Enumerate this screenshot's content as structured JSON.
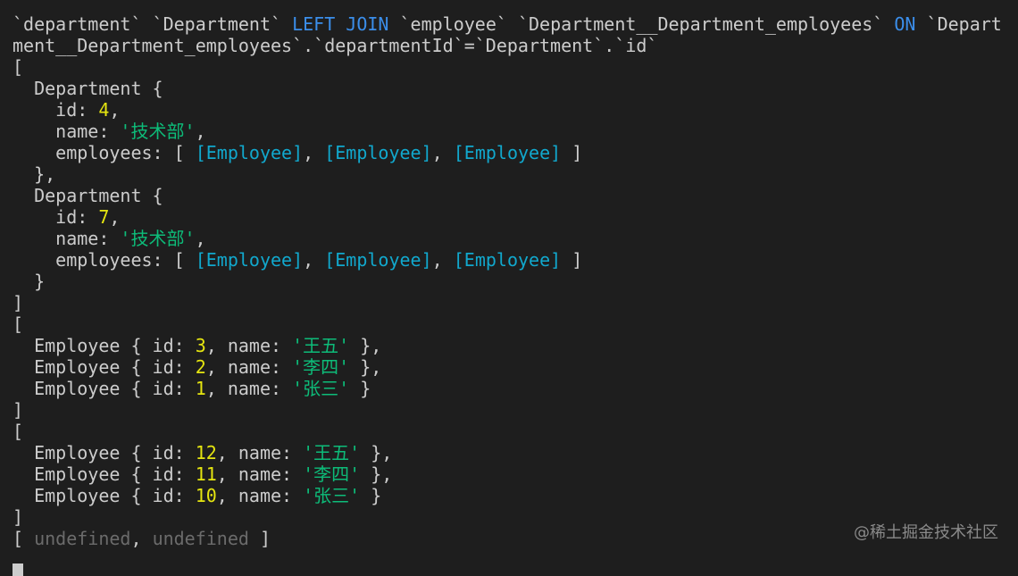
{
  "lines": [
    [
      {
        "t": "`department` `Department` ",
        "c": "def"
      },
      {
        "t": "LEFT JOIN",
        "c": "kw"
      },
      {
        "t": " `employee` `Department__Department_employees` ",
        "c": "def"
      },
      {
        "t": "ON",
        "c": "kw"
      },
      {
        "t": " `Depart",
        "c": "def"
      }
    ],
    [
      {
        "t": "ment__Department_employees`.`departmentId`=`Department`.`id`",
        "c": "def"
      }
    ],
    [
      {
        "t": "[",
        "c": "def"
      }
    ],
    [
      {
        "t": "  Department {",
        "c": "def"
      }
    ],
    [
      {
        "t": "    id: ",
        "c": "def"
      },
      {
        "t": "4",
        "c": "num"
      },
      {
        "t": ",",
        "c": "def"
      }
    ],
    [
      {
        "t": "    name: ",
        "c": "def"
      },
      {
        "t": "'技术部'",
        "c": "str"
      },
      {
        "t": ",",
        "c": "def"
      }
    ],
    [
      {
        "t": "    employees: [ ",
        "c": "def"
      },
      {
        "t": "[Employee]",
        "c": "cls"
      },
      {
        "t": ", ",
        "c": "def"
      },
      {
        "t": "[Employee]",
        "c": "cls"
      },
      {
        "t": ", ",
        "c": "def"
      },
      {
        "t": "[Employee]",
        "c": "cls"
      },
      {
        "t": " ]",
        "c": "def"
      }
    ],
    [
      {
        "t": "  },",
        "c": "def"
      }
    ],
    [
      {
        "t": "  Department {",
        "c": "def"
      }
    ],
    [
      {
        "t": "    id: ",
        "c": "def"
      },
      {
        "t": "7",
        "c": "num"
      },
      {
        "t": ",",
        "c": "def"
      }
    ],
    [
      {
        "t": "    name: ",
        "c": "def"
      },
      {
        "t": "'技术部'",
        "c": "str"
      },
      {
        "t": ",",
        "c": "def"
      }
    ],
    [
      {
        "t": "    employees: [ ",
        "c": "def"
      },
      {
        "t": "[Employee]",
        "c": "cls"
      },
      {
        "t": ", ",
        "c": "def"
      },
      {
        "t": "[Employee]",
        "c": "cls"
      },
      {
        "t": ", ",
        "c": "def"
      },
      {
        "t": "[Employee]",
        "c": "cls"
      },
      {
        "t": " ]",
        "c": "def"
      }
    ],
    [
      {
        "t": "  }",
        "c": "def"
      }
    ],
    [
      {
        "t": "]",
        "c": "def"
      }
    ],
    [
      {
        "t": "[",
        "c": "def"
      }
    ],
    [
      {
        "t": "  Employee { id: ",
        "c": "def"
      },
      {
        "t": "3",
        "c": "num"
      },
      {
        "t": ", name: ",
        "c": "def"
      },
      {
        "t": "'王五'",
        "c": "str"
      },
      {
        "t": " },",
        "c": "def"
      }
    ],
    [
      {
        "t": "  Employee { id: ",
        "c": "def"
      },
      {
        "t": "2",
        "c": "num"
      },
      {
        "t": ", name: ",
        "c": "def"
      },
      {
        "t": "'李四'",
        "c": "str"
      },
      {
        "t": " },",
        "c": "def"
      }
    ],
    [
      {
        "t": "  Employee { id: ",
        "c": "def"
      },
      {
        "t": "1",
        "c": "num"
      },
      {
        "t": ", name: ",
        "c": "def"
      },
      {
        "t": "'张三'",
        "c": "str"
      },
      {
        "t": " }",
        "c": "def"
      }
    ],
    [
      {
        "t": "]",
        "c": "def"
      }
    ],
    [
      {
        "t": "[",
        "c": "def"
      }
    ],
    [
      {
        "t": "  Employee { id: ",
        "c": "def"
      },
      {
        "t": "12",
        "c": "num"
      },
      {
        "t": ", name: ",
        "c": "def"
      },
      {
        "t": "'王五'",
        "c": "str"
      },
      {
        "t": " },",
        "c": "def"
      }
    ],
    [
      {
        "t": "  Employee { id: ",
        "c": "def"
      },
      {
        "t": "11",
        "c": "num"
      },
      {
        "t": ", name: ",
        "c": "def"
      },
      {
        "t": "'李四'",
        "c": "str"
      },
      {
        "t": " },",
        "c": "def"
      }
    ],
    [
      {
        "t": "  Employee { id: ",
        "c": "def"
      },
      {
        "t": "10",
        "c": "num"
      },
      {
        "t": ", name: ",
        "c": "def"
      },
      {
        "t": "'张三'",
        "c": "str"
      },
      {
        "t": " }",
        "c": "def"
      }
    ],
    [
      {
        "t": "]",
        "c": "def"
      }
    ],
    [
      {
        "t": "[ ",
        "c": "def"
      },
      {
        "t": "undefined",
        "c": "dim"
      },
      {
        "t": ", ",
        "c": "def"
      },
      {
        "t": "undefined",
        "c": "dim"
      },
      {
        "t": " ]",
        "c": "def"
      }
    ]
  ],
  "watermark": "@稀土掘金技术社区"
}
